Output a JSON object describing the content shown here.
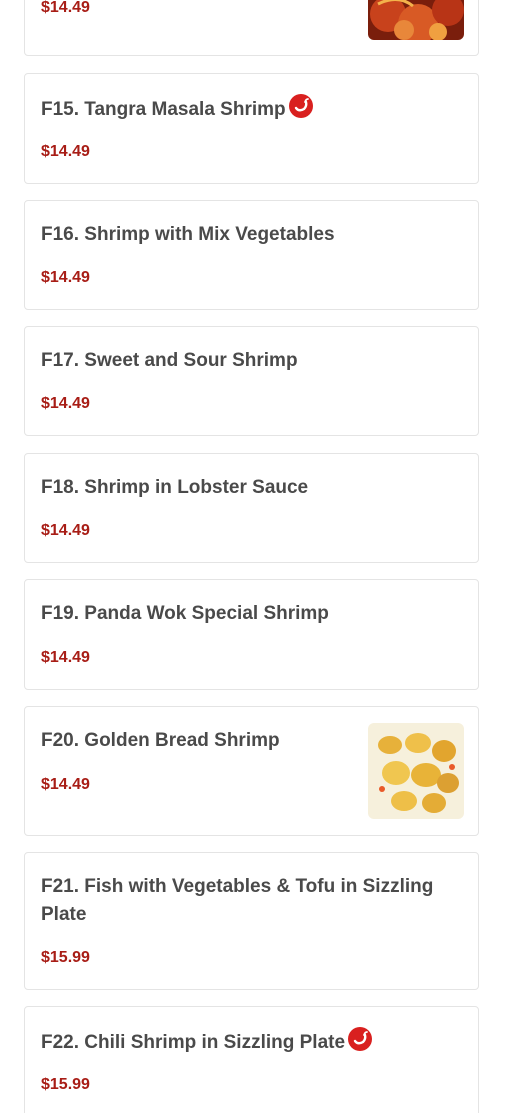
{
  "items": [
    {
      "id": "f14",
      "price": "$14.49"
    },
    {
      "id": "f15",
      "name": "F15. Tangra Masala Shrimp",
      "price": "$14.49",
      "spicy": true
    },
    {
      "id": "f16",
      "name": "F16. Shrimp with Mix Vegetables",
      "price": "$14.49"
    },
    {
      "id": "f17",
      "name": "F17. Sweet and Sour Shrimp",
      "price": "$14.49"
    },
    {
      "id": "f18",
      "name": "F18. Shrimp in Lobster Sauce",
      "price": "$14.49"
    },
    {
      "id": "f19",
      "name": "F19. Panda Wok Special Shrimp",
      "price": "$14.49"
    },
    {
      "id": "f20",
      "name": "F20. Golden Bread Shrimp",
      "price": "$14.49"
    },
    {
      "id": "f21",
      "name": "F21. Fish with Vegetables & Tofu in Sizzling Plate",
      "price": "$15.99"
    },
    {
      "id": "f22",
      "name": "F22. Chili Shrimp in Sizzling Plate",
      "price": "$15.99",
      "spicy": true
    }
  ],
  "icons": {
    "spicy": "chili-pepper-icon"
  },
  "colors": {
    "price": "#a81d16",
    "spicy_badge": "#d9201f",
    "card_border": "#e4e4e4",
    "name_text": "#4a4a4a"
  }
}
